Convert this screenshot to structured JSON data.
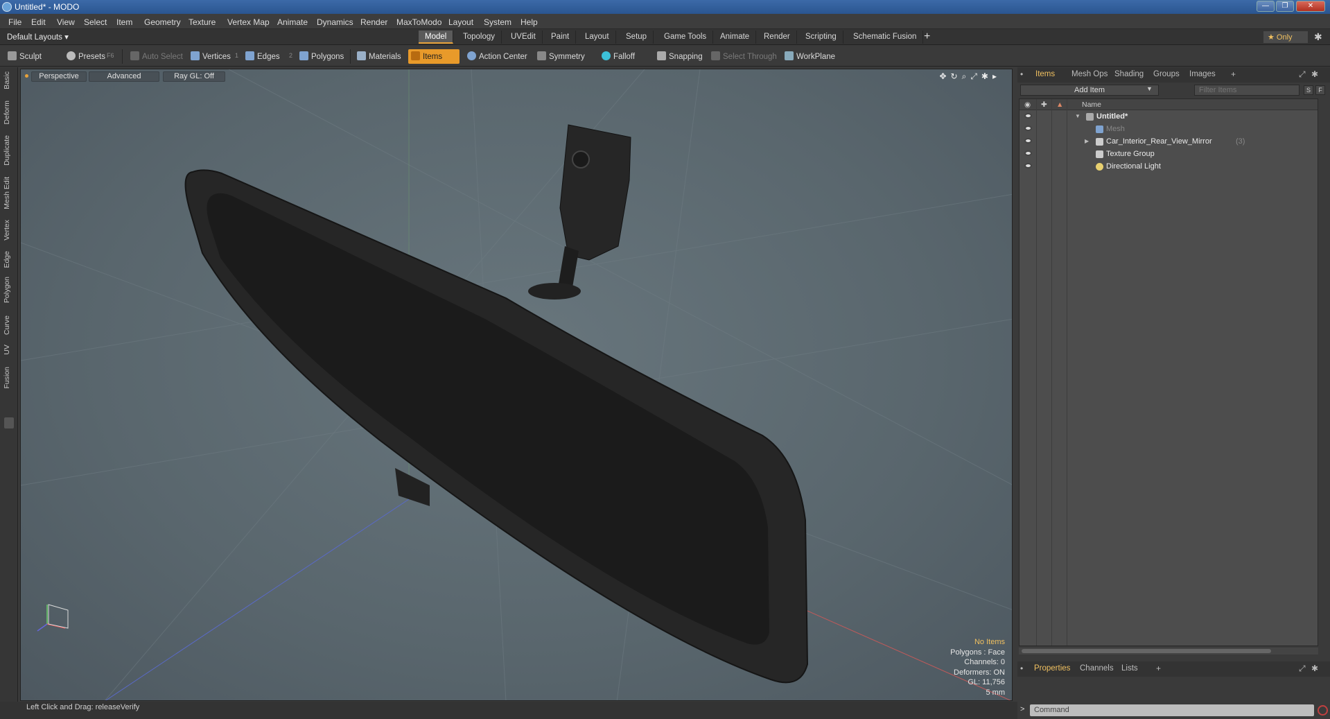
{
  "window": {
    "title": "Untitled* - MODO",
    "min_label": "—",
    "max_label": "❐",
    "close_label": "✕"
  },
  "menu": [
    "File",
    "Edit",
    "View",
    "Select",
    "Item",
    "Geometry",
    "Texture",
    "Vertex Map",
    "Animate",
    "Dynamics",
    "Render",
    "MaxToModo",
    "Layout",
    "System",
    "Help"
  ],
  "layout": {
    "selector": "Default Layouts ▾",
    "tabs": [
      "Model",
      "Topology",
      "UVEdit",
      "Paint",
      "Layout",
      "Setup",
      "Game Tools",
      "Animate",
      "Render",
      "Scripting",
      "Schematic Fusion"
    ],
    "active_tab": "Model",
    "plus": "+",
    "only": "★ Only",
    "gear": "✱"
  },
  "toolbar": {
    "sculpt": "Sculpt",
    "presets": "Presets",
    "presets_key": "F6",
    "auto_select": "Auto Select",
    "vertices": "Vertices",
    "vertices_key": "1",
    "edges": "Edges",
    "edges_key": "2",
    "polygons": "Polygons",
    "materials": "Materials",
    "items": "Items",
    "action_center": "Action Center",
    "symmetry": "Symmetry",
    "falloff": "Falloff",
    "snapping": "Snapping",
    "select_through": "Select Through",
    "workplane": "WorkPlane"
  },
  "left_tabs": [
    "Basic",
    "Deform",
    "Duplicate",
    "Mesh Edit",
    "Vertex",
    "Edge",
    "Polygon",
    "Curve",
    "UV",
    "Fusion"
  ],
  "viewport": {
    "view": "Perspective",
    "shading": "Advanced",
    "raygl": "Ray GL: Off",
    "icons": "✥↻⌕⤢✱▸",
    "info": {
      "no_items": "No Items",
      "polygons": "Polygons : Face",
      "channels": "Channels: 0",
      "deformers": "Deformers: ON",
      "gl": "GL: 11,756",
      "scale": "5 mm"
    }
  },
  "status": {
    "hint": "Left Click and Drag:   releaseVerify"
  },
  "right_panel": {
    "tabs": [
      "Items",
      "Mesh Ops",
      "Shading",
      "Groups",
      "Images"
    ],
    "active_tab": "Items",
    "plus": "+",
    "add_item": "Add Item",
    "filter_placeholder": "Filter Items",
    "btn_s": "S",
    "btn_f": "F",
    "col_name": "Name",
    "tree": [
      {
        "label": "Untitled*",
        "count": "",
        "level": 0
      },
      {
        "label": "Mesh",
        "count": "",
        "level": 1
      },
      {
        "label": "Car_Interior_Rear_View_Mirror",
        "count": "(3)",
        "level": 1
      },
      {
        "label": "Texture Group",
        "count": "",
        "level": 1
      },
      {
        "label": "Directional Light",
        "count": "",
        "level": 1
      }
    ],
    "bottom_tabs": [
      "Properties",
      "Channels",
      "Lists"
    ],
    "bottom_active": "Properties",
    "command_prompt": ">",
    "command_placeholder": "Command"
  },
  "colors": {
    "accent": "#e89a2a",
    "viewport_bg": "#5e6b72",
    "mirror": "#1f1f1f"
  }
}
